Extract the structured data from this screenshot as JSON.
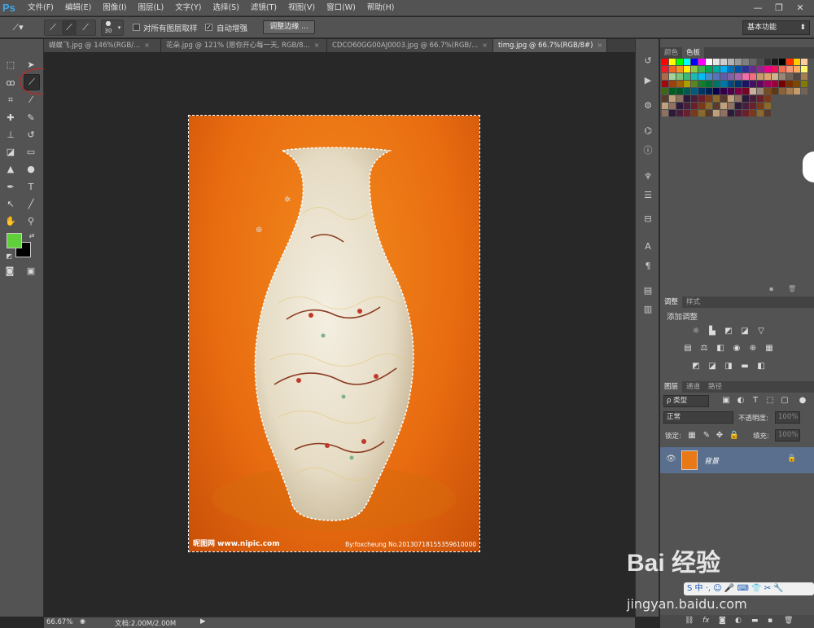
{
  "app": {
    "logo": "Ps"
  },
  "menu": [
    "文件(F)",
    "编辑(E)",
    "图像(I)",
    "图层(L)",
    "文字(Y)",
    "选择(S)",
    "滤镜(T)",
    "视图(V)",
    "窗口(W)",
    "帮助(H)"
  ],
  "window_controls": {
    "minimize": "—",
    "restore": "❐",
    "close": "✕"
  },
  "options": {
    "brush_size": "30",
    "sample_all_layers_label": "对所有图层取样",
    "sample_all_layers_checked": false,
    "auto_enhance_label": "自动增强",
    "auto_enhance_checked": true,
    "refine_edge_label": "调整边缘 ...",
    "workspace": "基本功能"
  },
  "tabs": [
    {
      "label": "蝴蝶飞.jpg @ 146%(RGB/...",
      "close": "×"
    },
    {
      "label": "花朵.jpg @ 121% (愿你开心每一天, RGB/8...",
      "close": "×"
    },
    {
      "label": "CDCO60GG00AJ0003.jpg @ 66.7%(RGB/...",
      "close": "×"
    },
    {
      "label": "timg.jpg @ 66.7%(RGB/8#)",
      "close": "×"
    }
  ],
  "image": {
    "watermark_left": "昵图网 www.nipic.com",
    "watermark_right": "By:foxcheung No.20130718155359610000"
  },
  "status": {
    "zoom": "66.67%",
    "doc": "文档:2.00M/2.00M"
  },
  "panels": {
    "swatch_tabs": [
      "颜色",
      "色板"
    ],
    "adjust_tabs": [
      "调整",
      "样式"
    ],
    "adjust_title": "添加调整",
    "layer_tabs": [
      "图层",
      "通道",
      "路径"
    ],
    "filter_kind": "ρ 类型",
    "blend_mode": "正常",
    "opacity_label": "不透明度:",
    "opacity_value": "100%",
    "lock_label": "锁定:",
    "fill_label": "填充:",
    "fill_value": "100%",
    "layer_name": "背景"
  },
  "baidu": {
    "logo": "Bai 经验",
    "url": "jingyan.baidu.com",
    "ime": "S 中 ·, ☺ 🎤 ⌨ 👕 ✂ 🔧"
  }
}
